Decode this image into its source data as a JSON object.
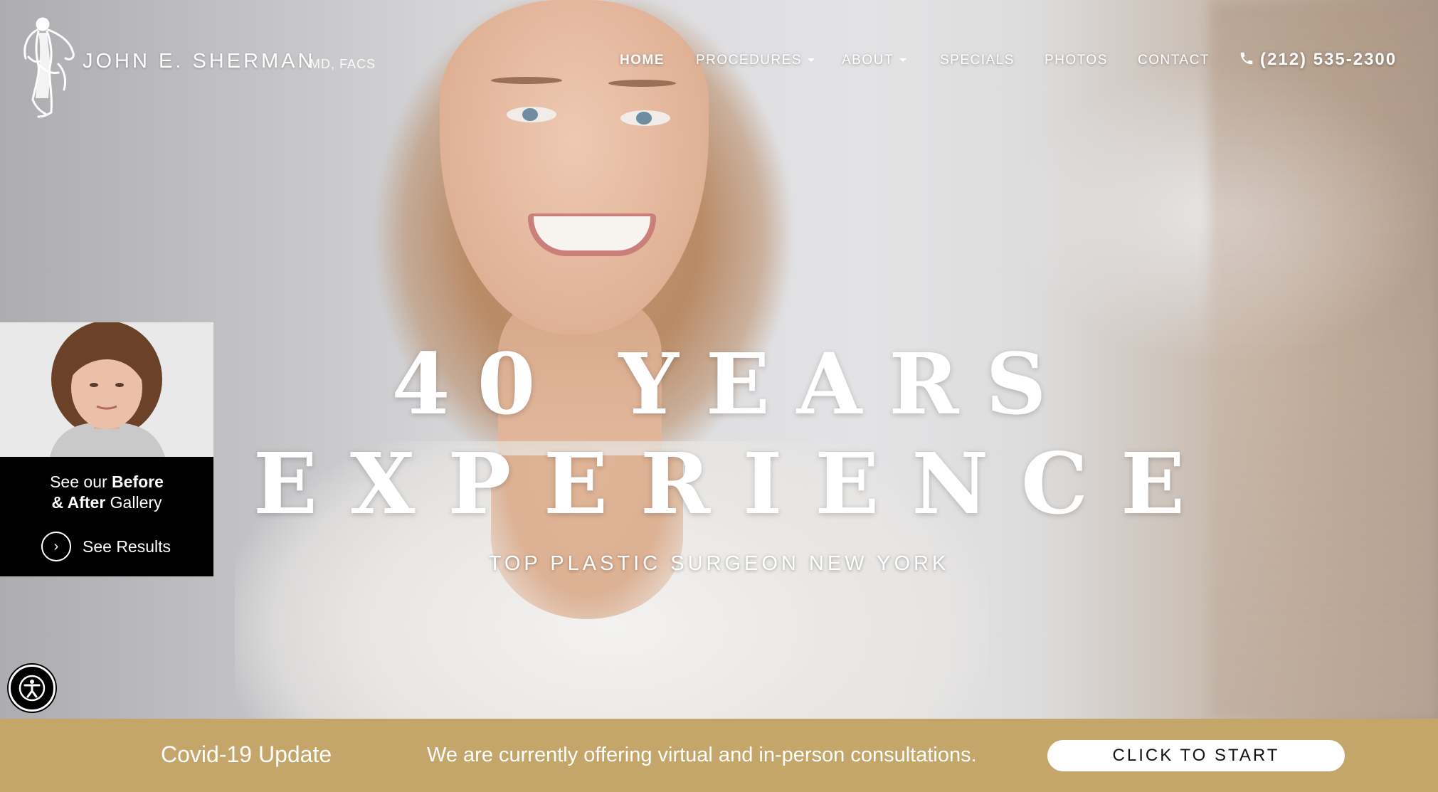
{
  "brand": {
    "name": "JOHN E. SHERMAN",
    "suffix": "MD, FACS",
    "logo_icon": "statue-figure-logo"
  },
  "nav": {
    "items": [
      {
        "label": "HOME",
        "active": true,
        "dropdown": false
      },
      {
        "label": "PROCEDURES",
        "active": false,
        "dropdown": true
      },
      {
        "label": "ABOUT",
        "active": false,
        "dropdown": true
      },
      {
        "label": "SPECIALS",
        "active": false,
        "dropdown": false
      },
      {
        "label": "PHOTOS",
        "active": false,
        "dropdown": false
      },
      {
        "label": "CONTACT",
        "active": false,
        "dropdown": false
      }
    ],
    "phone": "(212) 535-2300",
    "phone_icon": "phone-icon"
  },
  "hero": {
    "headline_line1": "40 YEARS",
    "headline_line2": "EXPERIENCE",
    "subheadline": "TOP PLASTIC SURGEON NEW YORK"
  },
  "gallery_promo": {
    "line1_prefix": "See our ",
    "line1_bold": "Before",
    "line2_bold": "& After",
    "line2_suffix": " Gallery",
    "cta_label": "See Results",
    "cta_icon": "chevron-right-circle-icon"
  },
  "accessibility": {
    "icon": "accessibility-icon"
  },
  "covid_bar": {
    "title": "Covid-19 Update",
    "message": "We are currently offering virtual and in-person consultations.",
    "button_label": "CLICK TO START"
  },
  "colors": {
    "covid_bar_bg": "#c4a56a",
    "promo_bg": "#000000",
    "text_light": "#ffffff"
  }
}
